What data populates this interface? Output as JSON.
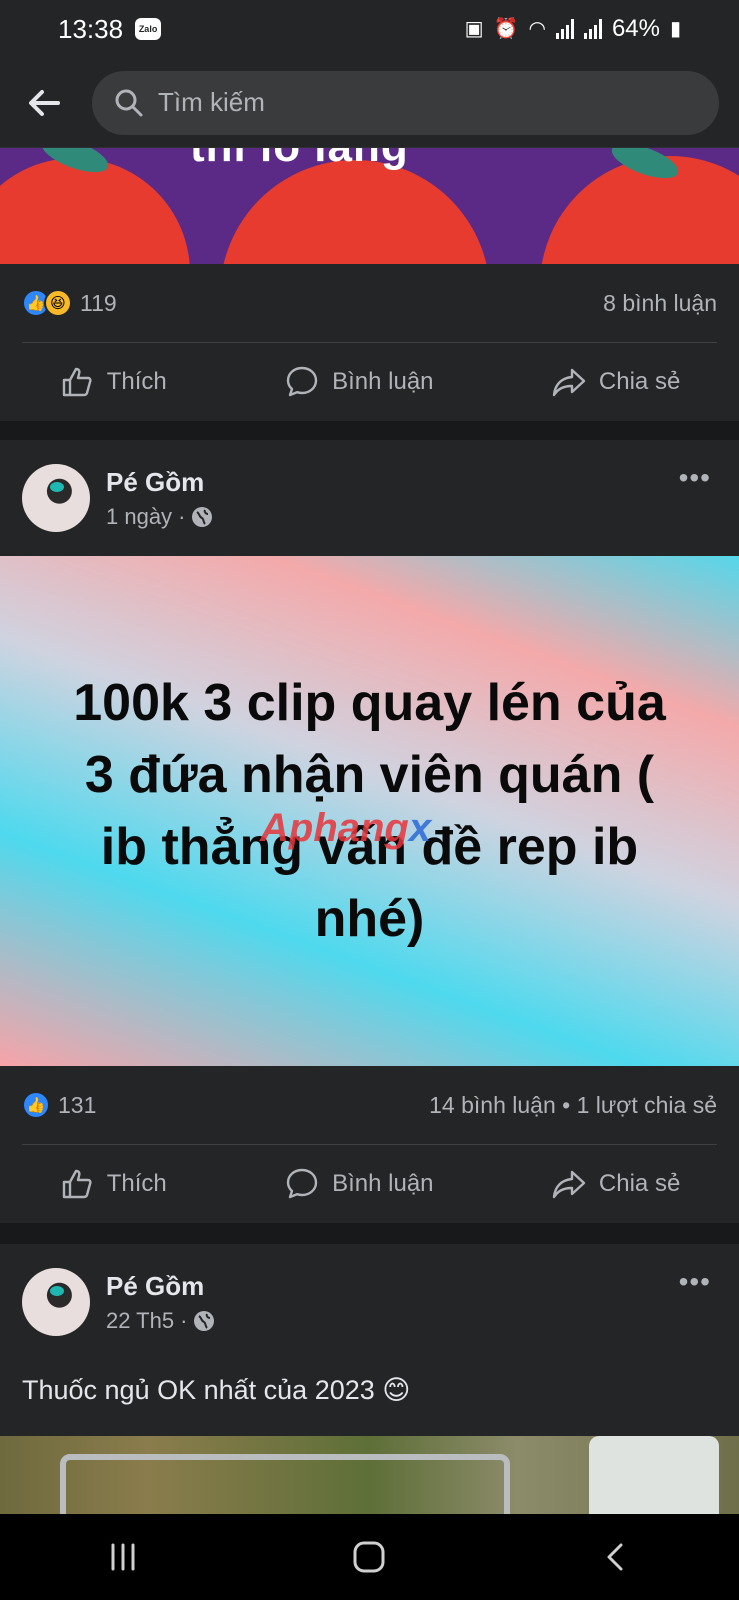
{
  "status_bar": {
    "time": "13:38",
    "zalo": "Zalo",
    "battery": "64%"
  },
  "search": {
    "placeholder": "Tìm kiếm"
  },
  "top_post": {
    "caption_fragment": "thi lo lắng",
    "reaction_count": "119",
    "comment_count": "8 bình luận"
  },
  "post1": {
    "author": "Pé Gồm",
    "time": "1 ngày",
    "visibility_dot": "·",
    "image_text": "100k 3 clip quay lén của 3 đứa nhận viên quán ( ib thẳng vấn đề rep ib nhé)",
    "watermark": "Aphangx",
    "reaction_count": "131",
    "stats": "14 bình luận • 1 lượt chia sẻ"
  },
  "post2": {
    "author": "Pé Gồm",
    "time": "22 Th5",
    "visibility_dot": "·",
    "caption": "Thuốc ngủ OK nhất của 2023 😊"
  },
  "actions": {
    "like": "Thích",
    "comment": "Bình luận",
    "share": "Chia sẻ"
  },
  "more": "•••",
  "colors": {
    "background": "#18191a",
    "card": "#242526",
    "secondary_text": "#b0b3b8",
    "like_blue": "#2d88ff"
  }
}
